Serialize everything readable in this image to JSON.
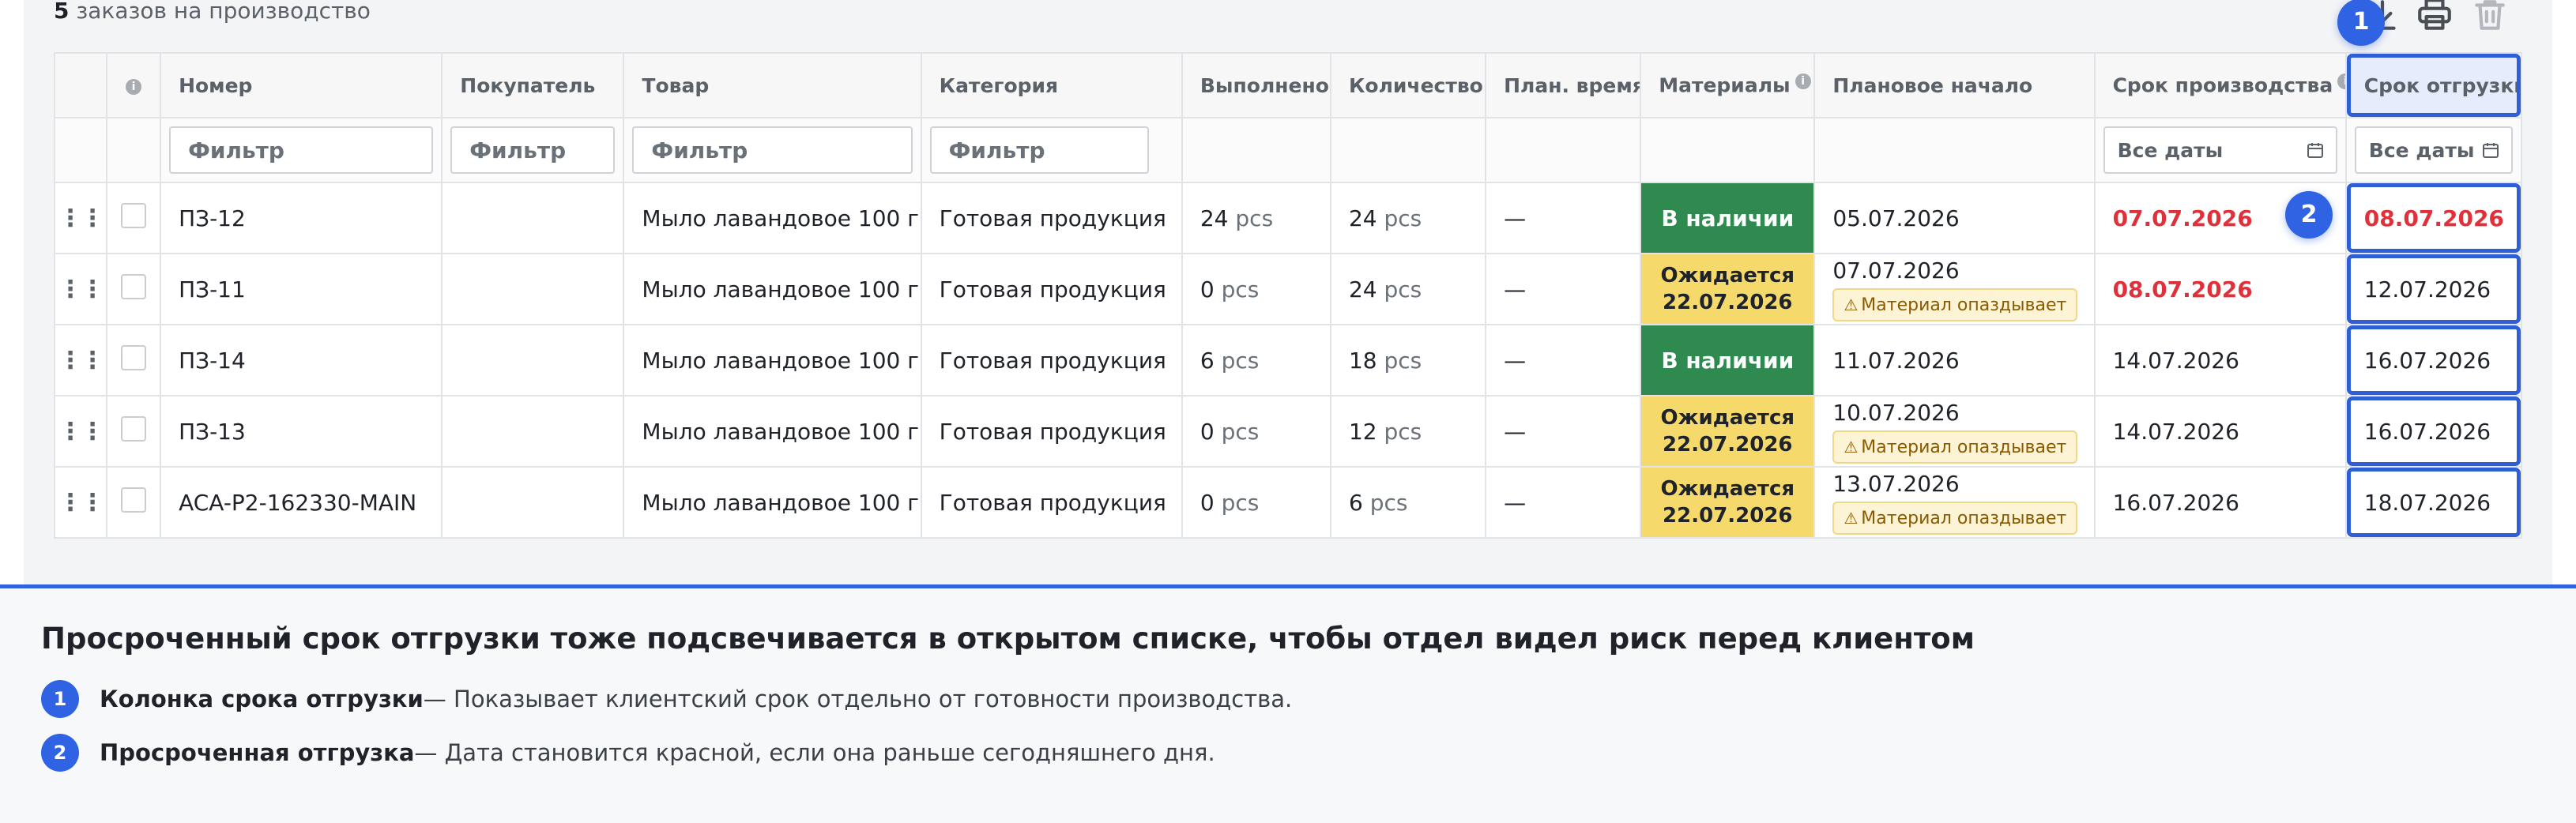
{
  "summary": {
    "count": "5",
    "text": " заказов на производство"
  },
  "toolbar": {
    "icons": [
      "download-icon",
      "print-icon",
      "trash-icon"
    ]
  },
  "table": {
    "columns": [
      "Номер",
      "Покупатель",
      "Товар",
      "Категория",
      "Выполнено",
      "Количество",
      "План. время",
      "Материалы",
      "Плановое начало",
      "Срок производства",
      "Срок отгрузки"
    ],
    "filters": {
      "number_placeholder": "Фильтр",
      "buyer_placeholder": "Фильтр",
      "product_placeholder": "Фильтр",
      "category_placeholder": "Фильтр",
      "production_date": "Все даты",
      "shipping_date": "Все даты"
    },
    "rows": [
      {
        "number": "ПЗ-12",
        "buyer": "",
        "product": "Мыло лавандовое 100 г",
        "category": "Готовая продукция",
        "done": "24",
        "done_unit": "pcs",
        "qty": "24",
        "qty_unit": "pcs",
        "plan_time": "—",
        "material": "В наличии",
        "start": "05.07.2026",
        "production_deadline": "07.07.2026",
        "shipping_deadline": "08.07.2026"
      },
      {
        "number": "ПЗ-11",
        "buyer": "",
        "product": "Мыло лавандовое 100 г",
        "category": "Готовая продукция",
        "done": "0",
        "done_unit": "pcs",
        "qty": "24",
        "qty_unit": "pcs",
        "plan_time": "—",
        "material": "Ожидается",
        "material_date": "22.07.2026",
        "start": "07.07.2026",
        "late_badge": "Материал опаздывает",
        "production_deadline": "08.07.2026",
        "shipping_deadline": "12.07.2026"
      },
      {
        "number": "ПЗ-14",
        "buyer": "",
        "product": "Мыло лавандовое 100 г",
        "category": "Готовая продукция",
        "done": "6",
        "done_unit": "pcs",
        "qty": "18",
        "qty_unit": "pcs",
        "plan_time": "—",
        "material": "В наличии",
        "start": "11.07.2026",
        "production_deadline": "14.07.2026",
        "shipping_deadline": "16.07.2026"
      },
      {
        "number": "ПЗ-13",
        "buyer": "",
        "product": "Мыло лавандовое 100 г",
        "category": "Готовая продукция",
        "done": "0",
        "done_unit": "pcs",
        "qty": "12",
        "qty_unit": "pcs",
        "plan_time": "—",
        "material": "Ожидается",
        "material_date": "22.07.2026",
        "start": "10.07.2026",
        "late_badge": "Материал опаздывает",
        "production_deadline": "14.07.2026",
        "shipping_deadline": "16.07.2026"
      },
      {
        "number": "ACA-P2-162330-MAIN",
        "buyer": "",
        "product": "Мыло лавандовое 100 г",
        "category": "Готовая продукция",
        "done": "0",
        "done_unit": "pcs",
        "qty": "6",
        "qty_unit": "pcs",
        "plan_time": "—",
        "material": "Ожидается",
        "material_date": "22.07.2026",
        "start": "13.07.2026",
        "late_badge": "Материал опаздывает",
        "production_deadline": "16.07.2026",
        "shipping_deadline": "18.07.2026"
      }
    ]
  },
  "markers": [
    "1",
    "2"
  ],
  "notes": {
    "title": "Просроченный срок отгрузки тоже подсвечивается в открытом списке, чтобы отдел видел риск перед клиентом",
    "items": [
      {
        "num": "1",
        "label": "Колонка срока отгрузки",
        "text": " — Показывает клиентский срок отдельно от готовности производства."
      },
      {
        "num": "2",
        "label": "Просроченная отгрузка",
        "text": " — Дата становится красной, если она раньше сегодняшнего дня."
      }
    ]
  },
  "colors": {
    "accent": "#2f63e3",
    "overdue": "#e0313a",
    "in_stock": "#2f8a4f",
    "awaiting": "#f5d96b"
  }
}
